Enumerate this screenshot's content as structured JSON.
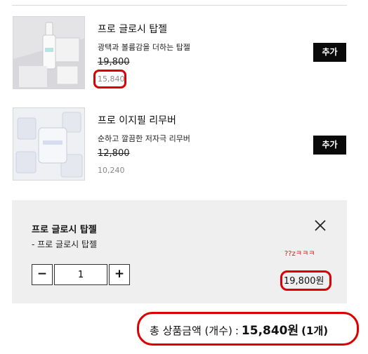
{
  "products": [
    {
      "name": "프로 글로시 탑젤",
      "description": "광택과 볼륨감을 더하는 탑젤",
      "original_price": "19,800",
      "sale_price": "15,840",
      "add_label": "추가",
      "image_icon": "product-photo-top-gel"
    },
    {
      "name": "프로 이지필 리무버",
      "description": "순하고 깔끔한 저자극 리무버",
      "original_price": "12,800",
      "sale_price": "10,240",
      "add_label": "추가",
      "image_icon": "product-photo-remover"
    }
  ],
  "selection": {
    "title": "프로 글로시 탑젤",
    "option": "- 프로 글로시 탑젤",
    "note": "??zㅋㅋㅋ",
    "minus_label": "−",
    "plus_label": "+",
    "quantity": "1",
    "price": "19,800원",
    "close_icon": "close-icon"
  },
  "summary": {
    "label": "총 상품금액 (개수)",
    "separator": ":",
    "amount": "15,840원",
    "count": "(1개)"
  },
  "colors": {
    "annotation": "#dd0000",
    "button_bg": "#0a0a0a",
    "panel_bg": "#efefef",
    "note": "#d11b1b"
  }
}
